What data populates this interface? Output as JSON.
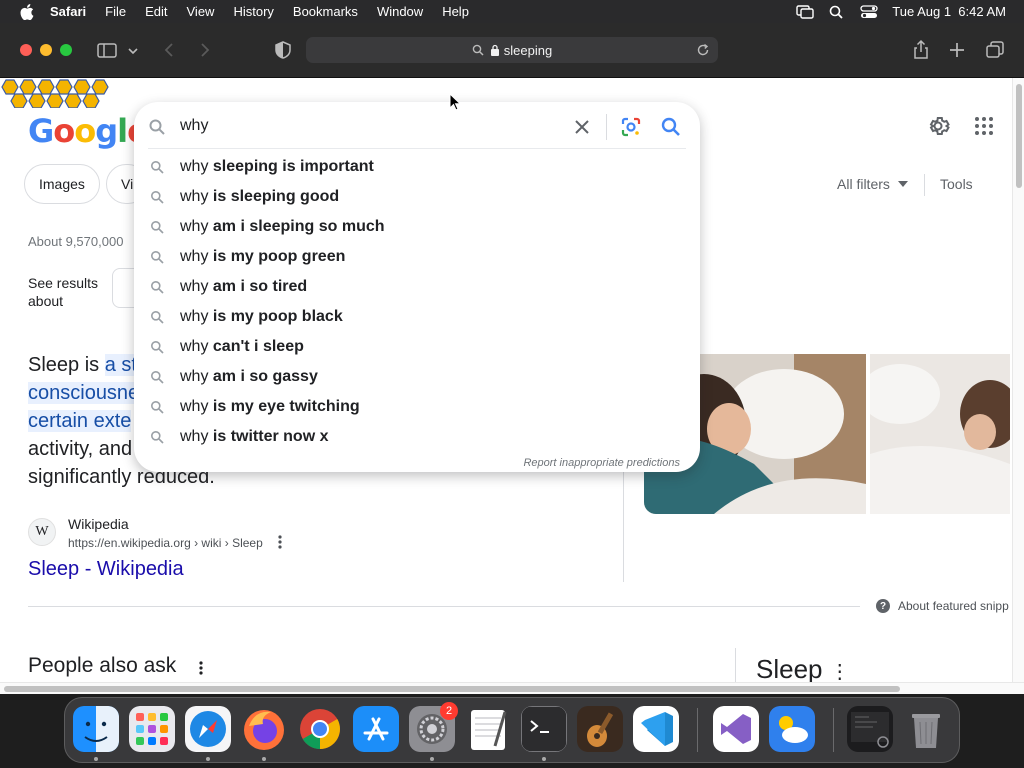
{
  "menubar": {
    "items": [
      "Safari",
      "File",
      "Edit",
      "View",
      "History",
      "Bookmarks",
      "Window",
      "Help"
    ],
    "datetime": "Tue Aug 1  6:42 AM"
  },
  "browser": {
    "url": "sleeping"
  },
  "google": {
    "logo": [
      "G",
      "o",
      "o",
      "g",
      "l",
      "e"
    ],
    "logo_colors": [
      "#4285f4",
      "#ea4335",
      "#fbbc05",
      "#4285f4",
      "#34a853",
      "#ea4335"
    ],
    "chips": [
      "Images",
      "Vi"
    ],
    "all_filters": "All filters",
    "tools": "Tools",
    "result_count": "About 9,570,000",
    "see_results_about": "See results about"
  },
  "search_dropdown": {
    "query": "why",
    "suggestions": [
      {
        "prefix": "why",
        "suffix": "sleeping is important"
      },
      {
        "prefix": "why",
        "suffix": "is sleeping good"
      },
      {
        "prefix": "why",
        "suffix": "am i sleeping so much"
      },
      {
        "prefix": "why",
        "suffix": "is my poop green"
      },
      {
        "prefix": "why",
        "suffix": "am i so tired"
      },
      {
        "prefix": "why",
        "suffix": "is my poop black"
      },
      {
        "prefix": "why",
        "suffix": "can't i sleep"
      },
      {
        "prefix": "why",
        "suffix": "am i so gassy"
      },
      {
        "prefix": "why",
        "suffix": "is my eye twitching"
      },
      {
        "prefix": "why",
        "suffix": "is twitter now x"
      }
    ],
    "report": "Report inappropriate predictions"
  },
  "snippet": {
    "line1_pre": "Sleep is ",
    "line1_hl": "a st",
    "line2_hl": "consciousne",
    "line3_hl": "certain exte",
    "line4": "activity, and",
    "line5": "significantly reduced."
  },
  "result": {
    "source": "Wikipedia",
    "favicon": "W",
    "url": "https://en.wikipedia.org › wiki › Sleep",
    "title": "Sleep - Wikipedia"
  },
  "about_featured": "About featured snipp",
  "people_also_ask": "People also ask",
  "knowledge_panel_title": "Sleep",
  "dock": {
    "apps": [
      "finder",
      "launchpad",
      "safari",
      "firefox",
      "chrome",
      "app-store",
      "system-settings",
      "textedit",
      "terminal",
      "garageband",
      "vscode",
      "visual-studio",
      "weather",
      "window-preview",
      "trash"
    ],
    "settings_badge": "2"
  }
}
